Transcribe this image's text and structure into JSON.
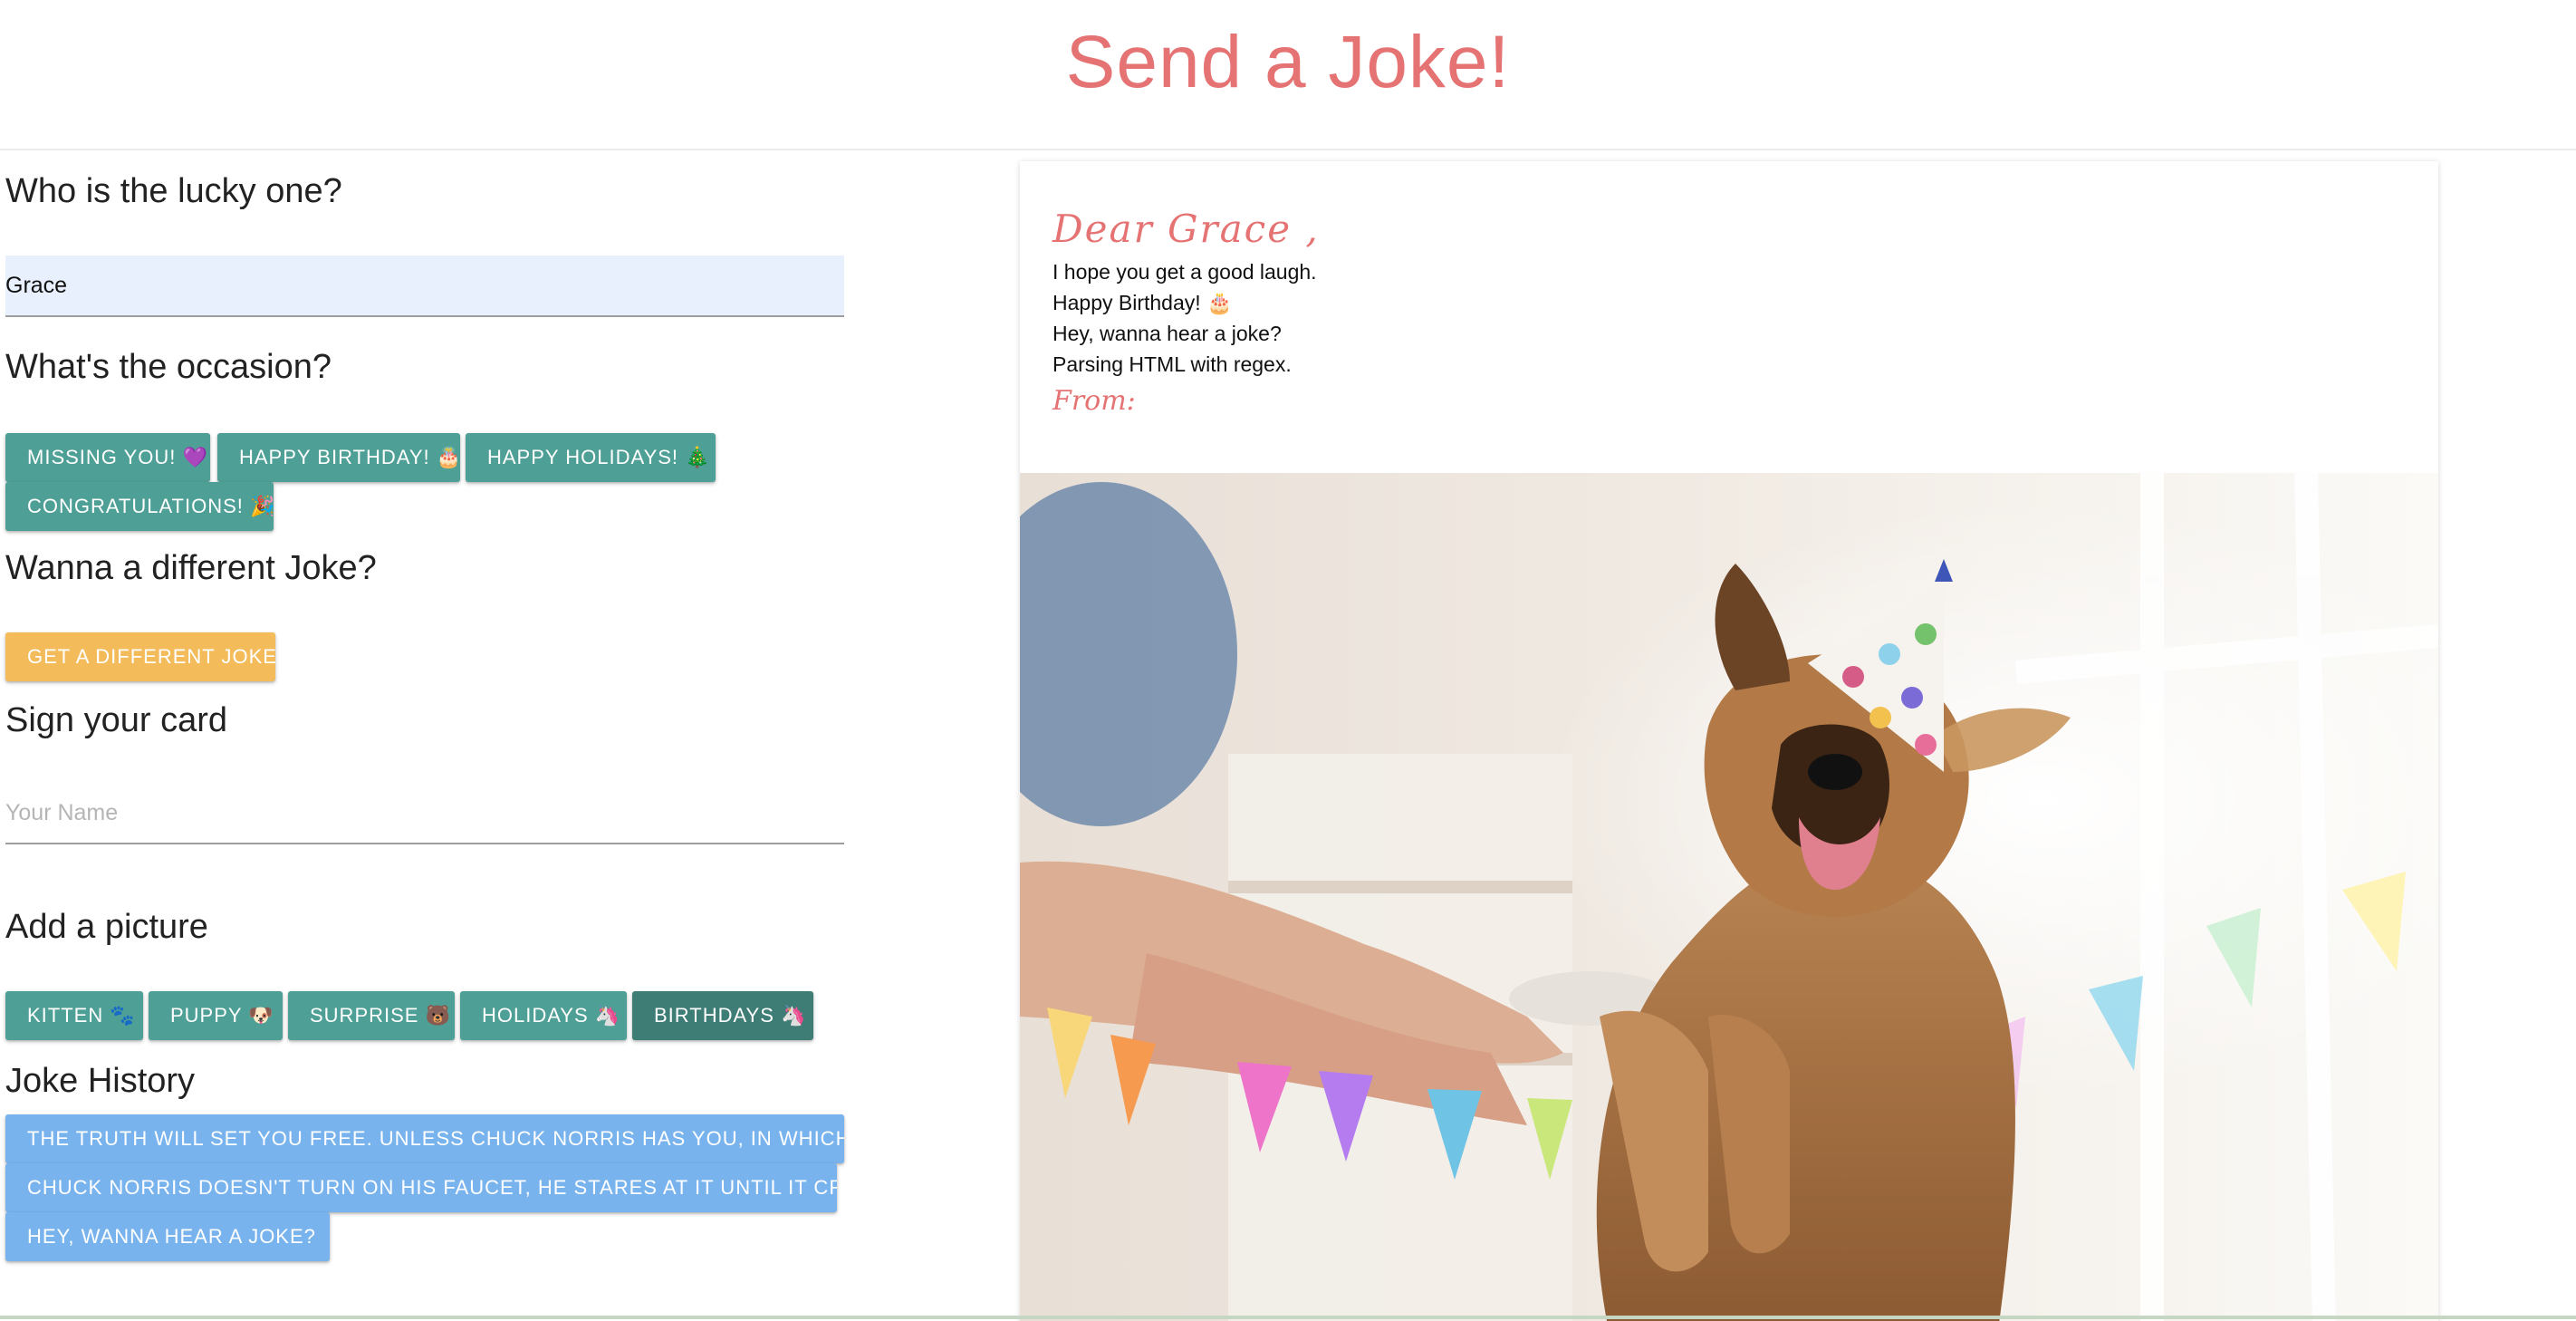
{
  "header": {
    "title": "Send a Joke!"
  },
  "recipient": {
    "title": "Who is the lucky one?",
    "value": "Grace"
  },
  "occasion": {
    "title": "What's the occasion?",
    "buttons": [
      "Missing you! 💜",
      "Happy Birthday! 🎂",
      "Happy Holidays! 🎄",
      "Congratulations! 🎉"
    ]
  },
  "different_joke": {
    "title": "Wanna a different Joke?",
    "button": "Get a different joke"
  },
  "sign": {
    "title": "Sign your card",
    "placeholder": "Your Name",
    "value": ""
  },
  "picture": {
    "title": "Add a picture",
    "buttons": [
      "Kitten 🐾",
      "Puppy 🐶",
      "Surprise 🐻",
      "Holidays 🦄",
      "Birthdays 🦄"
    ],
    "selected": "Birthdays 🦄"
  },
  "history": {
    "title": "Joke History",
    "items": [
      "The truth will set you free. Unless Chuck Norris has you, in which",
      "Chuck Norris doesn't turn on his faucet, he stares at it until it cries.",
      "Hey, wanna hear a joke?"
    ]
  },
  "card": {
    "greeting": "Dear Grace ,",
    "lines": [
      "I hope you get a good laugh.",
      "Happy Birthday! 🎂",
      "Hey, wanna hear a joke?",
      "Parsing HTML with regex."
    ],
    "from": "From:",
    "image_icon": "party-dog-photo"
  },
  "colors": {
    "title": "#e57373",
    "teal": "#4e9f95",
    "amber": "#f4bb5b",
    "blue": "#78b3ed"
  }
}
